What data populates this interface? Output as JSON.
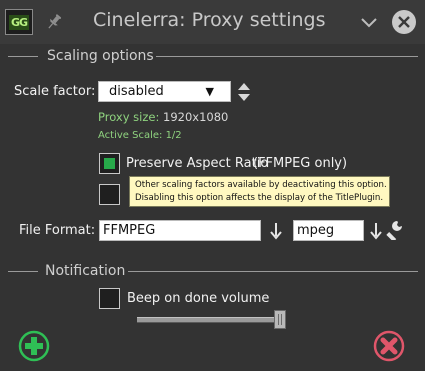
{
  "window": {
    "title": "Cinelerra: Proxy settings",
    "app_icon_text": "GG"
  },
  "scaling": {
    "section_title": "Scaling options",
    "scale_factor_label": "Scale factor:",
    "scale_factor_value": "disabled",
    "proxy_size_label": "Proxy size:",
    "proxy_size_value": "1920x1080",
    "active_scale": "Active Scale: 1/2",
    "preserve_aspect": {
      "label": "Preserve Aspect Ratio",
      "note": "(FFMPEG only)",
      "checked": true
    },
    "second_option_checked": false
  },
  "tooltip": {
    "line1": "Other scaling factors available by deactivating this option.",
    "line2": "Disabling this option affects the display of the TitlePlugin."
  },
  "file_format": {
    "label": "File Format:",
    "format_value": "FFMPEG",
    "codec_value": "mpeg"
  },
  "notification": {
    "section_title": "Notification",
    "beep_label": "Beep on done volume",
    "beep_checked": false,
    "volume_fraction": 1.0
  },
  "colors": {
    "ok_green": "#2fbf55",
    "cancel_red": "#e0566a",
    "checkbox_fill": "#27a94a",
    "tooltip_bg": "#fff8c0"
  },
  "icons": {
    "pin": "pin-icon",
    "chevron": "chevron-down-icon",
    "close": "close-icon",
    "spinner": "up-down-arrows-icon",
    "format_menu": "down-arrow-icon",
    "wrench": "wrench-icon",
    "ok": "plus-circle-icon",
    "cancel": "x-circle-icon"
  }
}
